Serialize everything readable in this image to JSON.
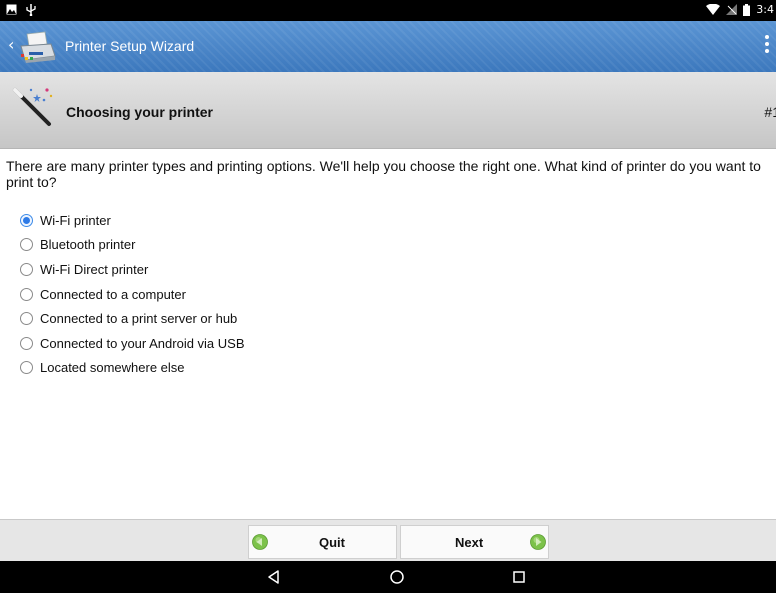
{
  "status_bar": {
    "time": "3:4",
    "icons": [
      "gallery-icon",
      "usb-icon",
      "wifi-icon",
      "signal-icon",
      "battery-icon"
    ]
  },
  "app_bar": {
    "title": "Printer Setup Wizard",
    "icons": [
      "back-icon",
      "printer-app-icon",
      "overflow-menu-icon"
    ]
  },
  "wizard": {
    "title": "Choosing your printer",
    "step": "#1",
    "icon": "magic-wand-icon"
  },
  "intro_text": "There are many printer types and printing options. We'll help you choose the right one. What kind of printer do you want to print to?",
  "options": [
    {
      "label": "Wi-Fi printer",
      "selected": true
    },
    {
      "label": "Bluetooth printer",
      "selected": false
    },
    {
      "label": "Wi-Fi Direct printer",
      "selected": false
    },
    {
      "label": "Connected to a computer",
      "selected": false
    },
    {
      "label": "Connected to a print server or hub",
      "selected": false
    },
    {
      "label": "Connected to your Android via USB",
      "selected": false
    },
    {
      "label": "Located somewhere else",
      "selected": false
    }
  ],
  "footer": {
    "quit_label": "Quit",
    "next_label": "Next"
  },
  "nav_bar": {
    "icons": [
      "nav-back-icon",
      "nav-home-icon",
      "nav-recents-icon"
    ]
  },
  "colors": {
    "app_bar": "#4a86c8",
    "accent_radio": "#2d7ae6",
    "arrow_green": "#7cc24a"
  }
}
